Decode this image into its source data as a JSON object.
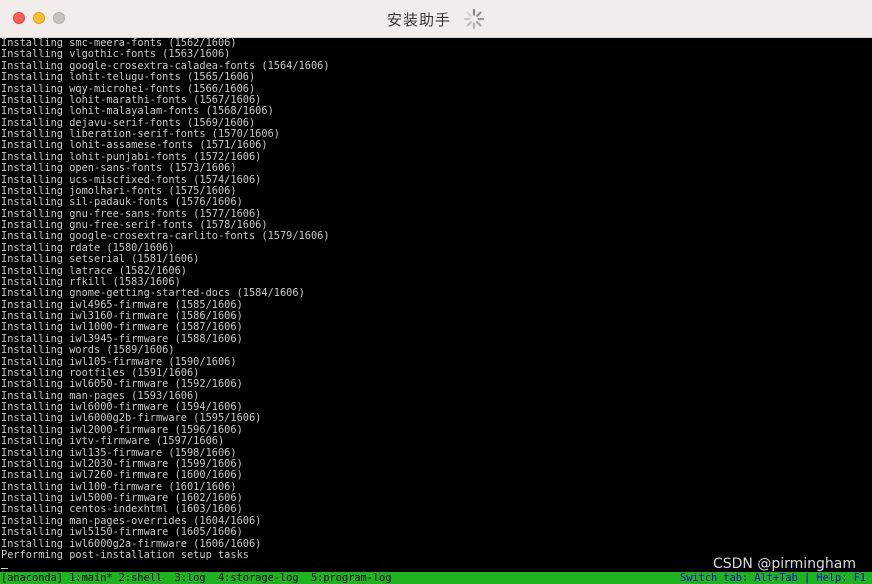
{
  "window": {
    "title": "安装助手"
  },
  "log_lines": [
    "Installing smc-meera-fonts (1562/1606)",
    "Installing vlgothic-fonts (1563/1606)",
    "Installing google-crosextra-caladea-fonts (1564/1606)",
    "Installing lohit-telugu-fonts (1565/1606)",
    "Installing wqy-microhei-fonts (1566/1606)",
    "Installing lohit-marathi-fonts (1567/1606)",
    "Installing lohit-malayalam-fonts (1568/1606)",
    "Installing dejavu-serif-fonts (1569/1606)",
    "Installing liberation-serif-fonts (1570/1606)",
    "Installing lohit-assamese-fonts (1571/1606)",
    "Installing lohit-punjabi-fonts (1572/1606)",
    "Installing open-sans-fonts (1573/1606)",
    "Installing ucs-miscfixed-fonts (1574/1606)",
    "Installing jomolhari-fonts (1575/1606)",
    "Installing sil-padauk-fonts (1576/1606)",
    "Installing gnu-free-sans-fonts (1577/1606)",
    "Installing gnu-free-serif-fonts (1578/1606)",
    "Installing google-crosextra-carlito-fonts (1579/1606)",
    "Installing rdate (1580/1606)",
    "Installing setserial (1581/1606)",
    "Installing latrace (1582/1606)",
    "Installing rfkill (1583/1606)",
    "Installing gnome-getting-started-docs (1584/1606)",
    "Installing iwl4965-firmware (1585/1606)",
    "Installing iwl3160-firmware (1586/1606)",
    "Installing iwl1000-firmware (1587/1606)",
    "Installing iwl3945-firmware (1588/1606)",
    "Installing words (1589/1606)",
    "Installing iwl105-firmware (1590/1606)",
    "Installing rootfiles (1591/1606)",
    "Installing iwl6050-firmware (1592/1606)",
    "Installing man-pages (1593/1606)",
    "Installing iwl6000-firmware (1594/1606)",
    "Installing iwl6000g2b-firmware (1595/1606)",
    "Installing iwl2000-firmware (1596/1606)",
    "Installing ivtv-firmware (1597/1606)",
    "Installing iwl135-firmware (1598/1606)",
    "Installing iwl2030-firmware (1599/1606)",
    "Installing iwl7260-firmware (1600/1606)",
    "Installing iwl100-firmware (1601/1606)",
    "Installing iwl5000-firmware (1602/1606)",
    "Installing centos-indexhtml (1603/1606)",
    "Installing man-pages-overrides (1604/1606)",
    "Installing iwl5150-firmware (1605/1606)",
    "Installing iwl6000g2a-firmware (1606/1606)",
    "Performing post-installation setup tasks"
  ],
  "statusbar": {
    "left": "[anaconda] 1:main* 2:shell  3:log  4:storage-log  5:program-log",
    "right": "Switch tab: Alt+Tab | Help: F1"
  },
  "watermark": "CSDN @pirmingham",
  "colors": {
    "terminal_bg": "#000000",
    "terminal_text": "#c9c9c9",
    "statusbar_bg": "#1fb31f",
    "titlebar_bg": "#f3ecec"
  },
  "icons": {
    "spinner": "loading-spinner-icon",
    "close": "close-dot-icon",
    "minimize": "minimize-dot-icon",
    "zoom": "zoom-dot-icon"
  }
}
